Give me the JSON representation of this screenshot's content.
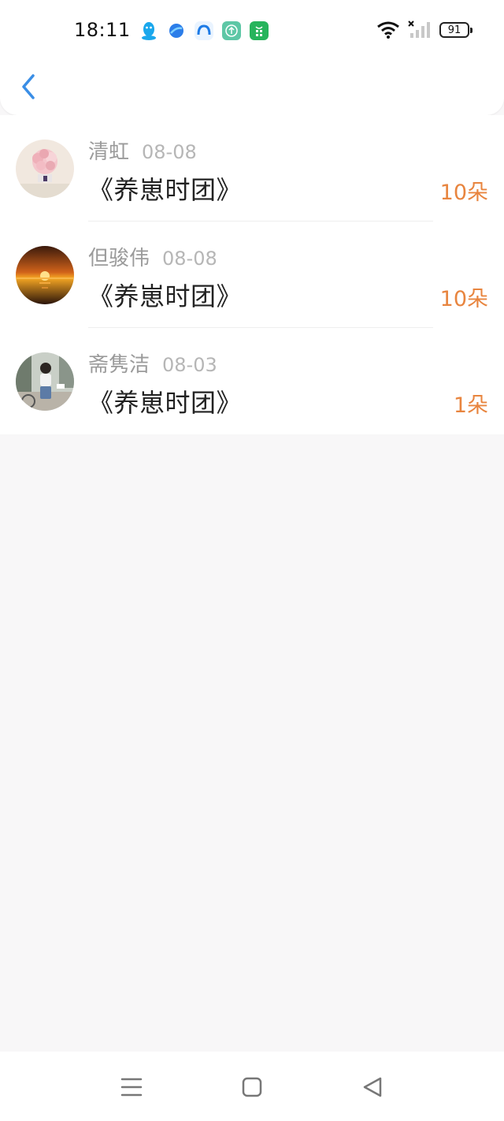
{
  "status_bar": {
    "time": "18:11",
    "battery": "91",
    "app_icons": [
      "qq-icon",
      "blue-app-icon",
      "cloud-app-icon",
      "upload-app-icon",
      "store-app-icon"
    ],
    "status_icons": [
      "wifi-icon",
      "no-signal-icon",
      "battery-icon"
    ]
  },
  "nav": {
    "back_icon": "chevron-left-icon",
    "accent_color": "#3a8ee6"
  },
  "list": {
    "items": [
      {
        "name": "清虹",
        "date": "08-08",
        "title": "《养崽时团》",
        "count": "10朵",
        "avatar": "flowers-avatar"
      },
      {
        "name": "但骏伟",
        "date": "08-08",
        "title": "《养崽时团》",
        "count": "10朵",
        "avatar": "sunset-avatar"
      },
      {
        "name": "斋隽洁",
        "date": "08-03",
        "title": "《养崽时团》",
        "count": "1朵",
        "avatar": "person-avatar"
      }
    ]
  },
  "colors": {
    "count": "#e8853f",
    "name": "#9b9b9b",
    "title": "#222222",
    "background": "#f8f7f8"
  },
  "system_nav": [
    "menu-icon",
    "home-icon",
    "back-triangle-icon"
  ]
}
